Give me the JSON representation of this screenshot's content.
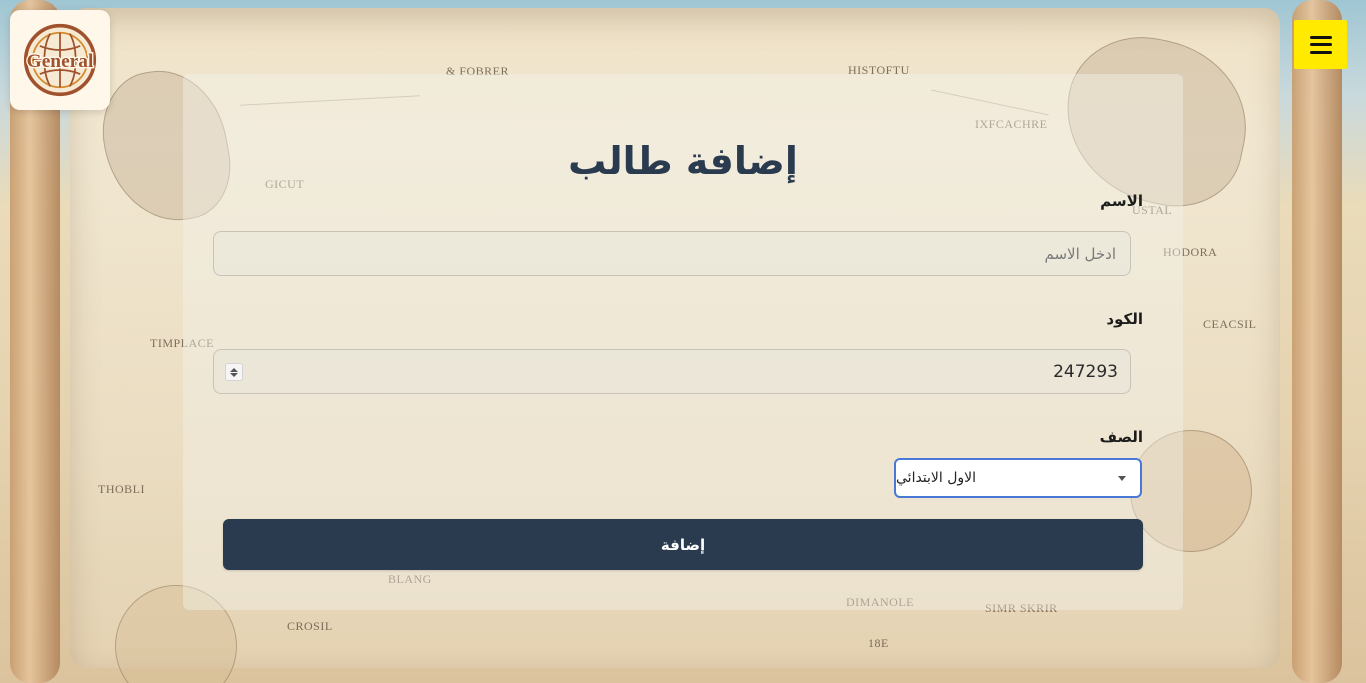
{
  "brand": {
    "logo_text": "General"
  },
  "header": {
    "menu_icon": "hamburger-menu-icon"
  },
  "form": {
    "title": "إضافة طالب",
    "name_label": "الاسم",
    "name_placeholder": "ادخل الاسم",
    "code_label": "الكود",
    "code_value": "247293",
    "class_label": "الصف",
    "class_selected": "الاول الابتدائي",
    "submit_label": "إضافة"
  },
  "background": {
    "map_labels": [
      "& FOBRER",
      "HISTOFTU",
      "IXFCACHRE",
      "GICUT",
      "USTAL",
      "HODORA",
      "TIMPLACE",
      "CEACSIL",
      "THOBLI",
      "BLANG",
      "DIMANOLE",
      "CROSIL",
      "SIMR SKRIR",
      "18E"
    ]
  },
  "colors": {
    "primary": "#2b3b4f",
    "menu_button": "#ffea00",
    "select_focus": "#4a78d6",
    "logo_brown": "#a0522d",
    "logo_gold": "#d38b2d"
  }
}
